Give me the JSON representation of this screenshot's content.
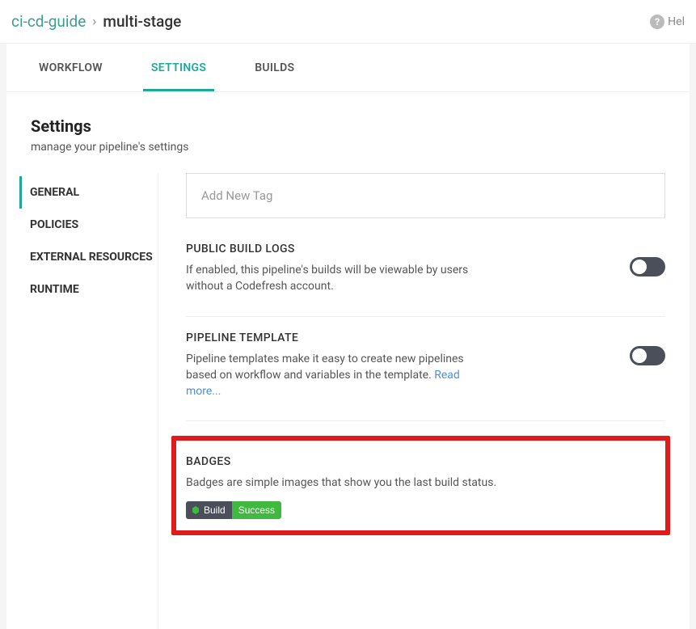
{
  "breadcrumb": {
    "parent": "ci-cd-guide",
    "sep": "›",
    "current": "multi-stage"
  },
  "help": {
    "label": "Hel"
  },
  "tabs": [
    {
      "label": "WORKFLOW",
      "active": false
    },
    {
      "label": "SETTINGS",
      "active": true
    },
    {
      "label": "BUILDS",
      "active": false
    }
  ],
  "page": {
    "title": "Settings",
    "subtitle": "manage your pipeline's settings"
  },
  "sidenav": [
    {
      "label": "GENERAL",
      "active": true
    },
    {
      "label": "POLICIES",
      "active": false
    },
    {
      "label": "EXTERNAL RESOURCES",
      "active": false
    },
    {
      "label": "RUNTIME",
      "active": false
    }
  ],
  "tag_input": {
    "placeholder": "Add New Tag"
  },
  "public_logs": {
    "title": "PUBLIC BUILD LOGS",
    "desc": "If enabled, this pipeline's builds will be viewable by users without a Codefresh account."
  },
  "template": {
    "title": "PIPELINE TEMPLATE",
    "desc": "Pipeline templates make it easy to create new pipelines based on workflow and variables in the template. ",
    "link": "Read more..."
  },
  "badges": {
    "title": "BADGES",
    "desc": "Badges are simple images that show you the last build status.",
    "badge_left": "Build",
    "badge_right": "Success"
  }
}
